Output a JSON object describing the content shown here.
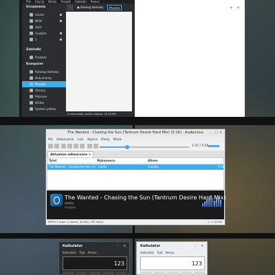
{
  "file_manager": {
    "menubar": [
      "Plik",
      "Edycja",
      "Widok",
      "Przejdź",
      "Zakładki",
      "Pomoc"
    ],
    "sections": {
      "devices": "Urządzenia",
      "bookmarks": "Zakładki",
      "computer": "Komputer"
    },
    "devices": [
      "reszta",
      "NEW",
      "dysk",
      "muzyka",
      "1"
    ],
    "bookmarks": [
      "Projekty"
    ],
    "computer": [
      "Katalog domowy",
      "Dokumenty",
      "Muzyka",
      "Obrazy",
      "Pobrane",
      "Wideo",
      "System plików"
    ],
    "selected_item": "Muzyka",
    "breadcrumb": [
      "Katalog domowy",
      "Muzyka"
    ],
    "status": "0 elementów, wolne miejsce: 161,8 MB"
  },
  "audacious": {
    "window_title": "The Wanted - Chasing the Sun (Tantrum Desire Hard Mix) (5:16) - Audacious",
    "menu": [
      "Plik",
      "Odtwarzanie",
      "Lista",
      "Wyjście",
      "Efekty",
      "Widok"
    ],
    "time": "1:37 / 5:16",
    "progress": 0.307,
    "volume": 0.8,
    "tab_label": "Aktualnie odtwarzane",
    "columns": {
      "title": "Tytuł",
      "artist": "Wykonawca",
      "album": "Album"
    },
    "rows": [
      {
        "title": "The Wanted - Chasing the Sun (Tan...",
        "artist": "media",
        "album": "muzyka",
        "length": "5:16"
      }
    ],
    "now_playing": {
      "title": "The Wanted - Chasing the Sun (Tantrum Desire Hard Mix)",
      "artist": "media",
      "album": "muzyka"
    },
    "visualizer_levels": [
      0.3,
      0.45,
      0.6,
      0.8,
      0.95,
      0.7,
      0.5,
      0.65,
      0.85,
      0.55
    ],
    "status_left": "MPEG-1 layer 3, stereo, 44 kHz, 192 kbit/s",
    "status_right": "1 / 1 (5:16)"
  },
  "calculator_dark": {
    "title": "Kalkulator",
    "menu": [
      "Kalkulator",
      "Tryb",
      "Pomoc"
    ],
    "display": "123"
  },
  "calculator_light": {
    "title": "Kalkulator",
    "menu": [
      "Kalkulator",
      "Tryb",
      "Pomoc"
    ],
    "display": "123"
  },
  "colors": {
    "accent": "#3daee9",
    "dark_bg": "#2b2d30"
  }
}
